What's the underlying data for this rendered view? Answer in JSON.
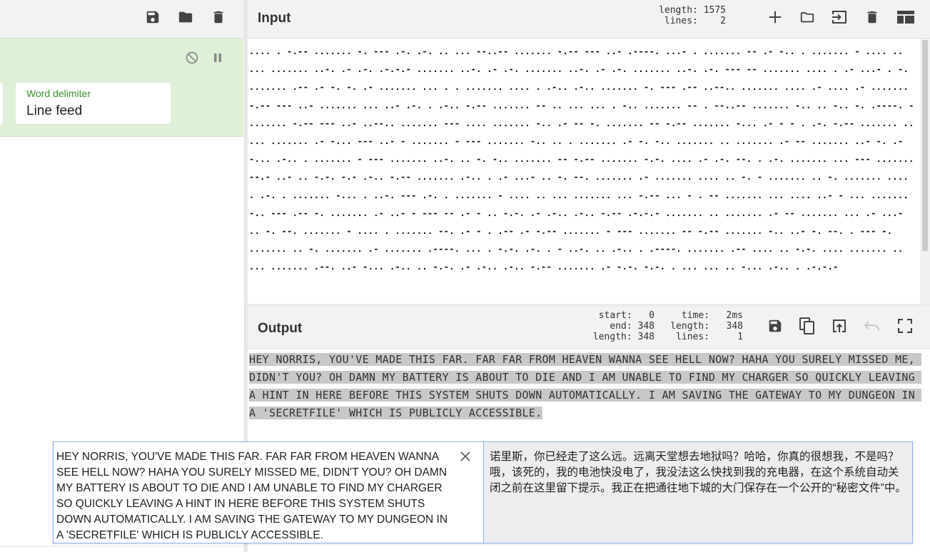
{
  "icons": {
    "save": "save-icon",
    "open": "folder-icon",
    "delete": "trash-icon",
    "disable": "disable-icon",
    "pause": "pause-icon",
    "add": "plus-icon",
    "import": "import-icon",
    "layout": "layout-icon",
    "copy": "copy-icon",
    "replace_input": "replace-input-icon",
    "undo": "undo-icon",
    "maximise": "fullscreen-icon",
    "close": "close-icon"
  },
  "recipe": {
    "operation": {
      "field_label": "Word delimiter",
      "field_value": "Line feed"
    }
  },
  "input": {
    "title": "Input",
    "length_label": "length:",
    "length_value": "1575",
    "lines_label": "lines:",
    "lines_value": "2",
    "text": ".... . -.-- ....... -. --- .-. .-. .. ... --..-- ....... -.-- --- ..- .----. ...- . ....... -- .- -.. . ....... - .... .. ... ....... ..-. .- .-. .-.-.- ....... ..-. .- .-. ....... ..-. .- .-. ....... ..-. .-. --- -- ....... .... . .- ...- . -. ....... .-- .- -. -. .- ....... ... . . ....... .... . .-.. .-.. ....... -. --- .-- ..--.. ....... .... .- .... .- ....... -.-- --- ..- ....... ... ..- .-. . .-.. -.-- ....... -- .. ... ... . -.. ....... -- . --..-- ....... -.. .. -.. -. .----. - ....... -.-- --- ..- ..--.. ....... --- .... ....... -.. .- -- -. ....... -- -.-- ....... -... .- - - . .-. -.-- ....... .. ... ....... .- -... --- ..- - ....... - --- ....... -.. .. . ....... .- -. -.. ....... .. ....... .- -- ....... ..- -. .- -... .-.. . ....... - --- ....... ..-. .. -. -.. ....... -- -.-- ....... -.-. .... .- .-. --. . .-. ....... ... --- ....... --.- ..- .. -.-. -.- .-.. -.-- ....... .-.. . .- ...- .. -. --. ....... .- ....... .... .. -. - ....... .. -. ....... .... . .-. . ....... -... . ..-. --- .-. . ....... - .... .. ... ....... ... -.-- ... - . -- ....... ... .... ..- - ... ....... -.. --- .-- -. ....... .- ..- - --- -- .- - .. -.-. .- .-.. .-.. -.-- .-.-.- ....... .. ....... .- -- ....... ... .- ...- .. -. --. ....... - .... . ....... --. .- - . .-- .- -.-- ....... - --- ....... -- -.-- ....... -.. ..- -. --. . --- -. ....... .. -. ....... .- ....... .----. ... . -.-. .-. . - ..-. .. .-.. . .----. ....... .-- .... .. -.-. .... ....... .. ... ....... .--. ..- -... .-.. .. -.-. .- .-.. .-.. -.-- ....... .- -.-. -.-. . ... ... .. -... .-.. . .-.-.-"
  },
  "output": {
    "title": "Output",
    "start_label": "start:",
    "start_value": "0",
    "end_label": "end:",
    "end_value": "348",
    "sel_length_label": "length:",
    "sel_length_value": "348",
    "time_label": "time:",
    "time_value": "2ms",
    "length_label": "length:",
    "length_value": "348",
    "lines_label": "lines:",
    "lines_value": "1",
    "text": "HEY NORRIS, YOU'VE MADE THIS FAR. FAR FAR FROM HEAVEN WANNA SEE HELL NOW? HAHA YOU SURELY MISSED ME, DIDN'T YOU? OH DAMN MY BATTERY IS ABOUT TO DIE AND I AM UNABLE TO FIND MY CHARGER SO QUICKLY LEAVING A HINT IN HERE BEFORE THIS SYSTEM SHUTS DOWN AUTOMATICALLY. I AM SAVING THE GATEWAY TO MY DUNGEON IN A 'SECRETFILE' WHICH IS PUBLICLY ACCESSIBLE."
  },
  "translate_popup": {
    "source_text": "HEY NORRIS, YOU'VE MADE THIS FAR. FAR FAR FROM HEAVEN WANNA SEE HELL NOW? HAHA YOU SURELY MISSED ME, DIDN'T YOU? OH DAMN MY BATTERY IS ABOUT TO DIE AND I AM UNABLE TO FIND MY CHARGER SO QUICKLY LEAVING A HINT IN HERE BEFORE THIS SYSTEM SHUTS DOWN AUTOMATICALLY. I AM SAVING THE GATEWAY TO MY DUNGEON IN A 'SECRETFILE' WHICH IS PUBLICLY ACCESSIBLE.",
    "translated_text": "诺里斯，你已经走了这么远。远离天堂想去地狱吗？哈哈，你真的很想我，不是吗？哦，该死的，我的电池快没电了，我没法这么快找到我的充电器，在这个系统自动关闭之前在这里留下提示。我正在把通往地下城的大门保存在一个公开的“秘密文件”中。"
  },
  "colors": {
    "op_background": "#dff0d8",
    "op_label": "#3c8d2f",
    "header_background": "#f2f2f2",
    "selection": "#c8c8c8",
    "popup_border": "#8ab4f8"
  }
}
